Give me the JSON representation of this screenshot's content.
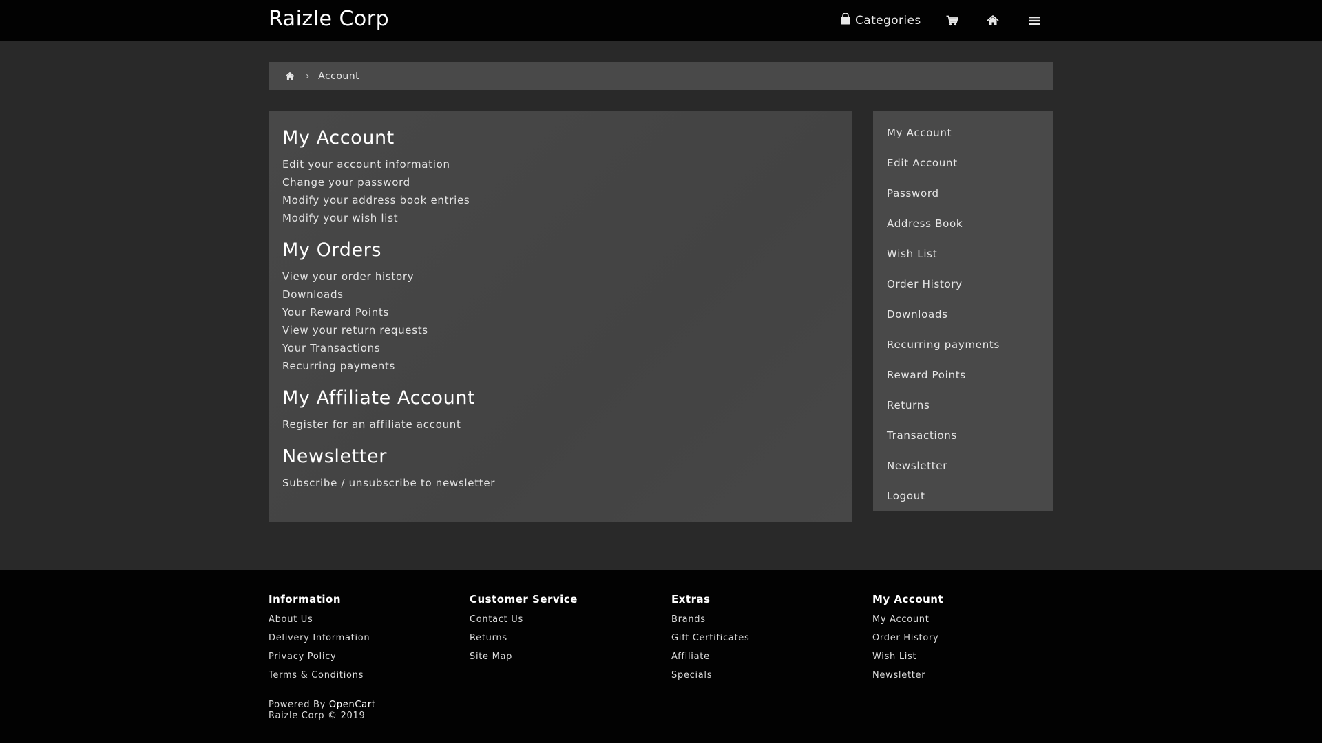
{
  "header": {
    "brand": "Raizle Corp",
    "categories_label": "Categories",
    "icons": [
      "shopping-bag-icon",
      "cart-icon",
      "home-icon",
      "menu-icon"
    ]
  },
  "breadcrumb": {
    "items": [
      "home-icon",
      "Account"
    ]
  },
  "main": {
    "sections": [
      {
        "title": "My Account",
        "links": [
          "Edit your account information",
          "Change your password",
          "Modify your address book entries",
          "Modify your wish list"
        ]
      },
      {
        "title": "My Orders",
        "links": [
          "View your order history",
          "Downloads",
          "Your Reward Points",
          "View your return requests",
          "Your Transactions",
          "Recurring payments"
        ]
      },
      {
        "title": "My Affiliate Account",
        "links": [
          "Register for an affiliate account"
        ]
      },
      {
        "title": "Newsletter",
        "links": [
          "Subscribe / unsubscribe to newsletter"
        ]
      }
    ]
  },
  "sidebar": {
    "items": [
      "My Account",
      "Edit Account",
      "Password",
      "Address Book",
      "Wish List",
      "Order History",
      "Downloads",
      "Recurring payments",
      "Reward Points",
      "Returns",
      "Transactions",
      "Newsletter",
      "Logout"
    ]
  },
  "footer": {
    "columns": [
      {
        "title": "Information",
        "links": [
          "About Us",
          "Delivery Information",
          "Privacy Policy",
          "Terms & Conditions"
        ]
      },
      {
        "title": "Customer Service",
        "links": [
          "Contact Us",
          "Returns",
          "Site Map"
        ]
      },
      {
        "title": "Extras",
        "links": [
          "Brands",
          "Gift Certificates",
          "Affiliate",
          "Specials"
        ]
      },
      {
        "title": "My Account",
        "links": [
          "My Account",
          "Order History",
          "Wish List",
          "Newsletter"
        ]
      }
    ],
    "powered_prefix": "Powered By",
    "powered_link": "OpenCart",
    "copyright": "Raizle Corp © 2019"
  },
  "colors": {
    "page_bg": "#292929",
    "header_bg": "#020202",
    "panel_bg": "#494949",
    "text": "#e6e6e6",
    "heading": "#ffffff"
  }
}
